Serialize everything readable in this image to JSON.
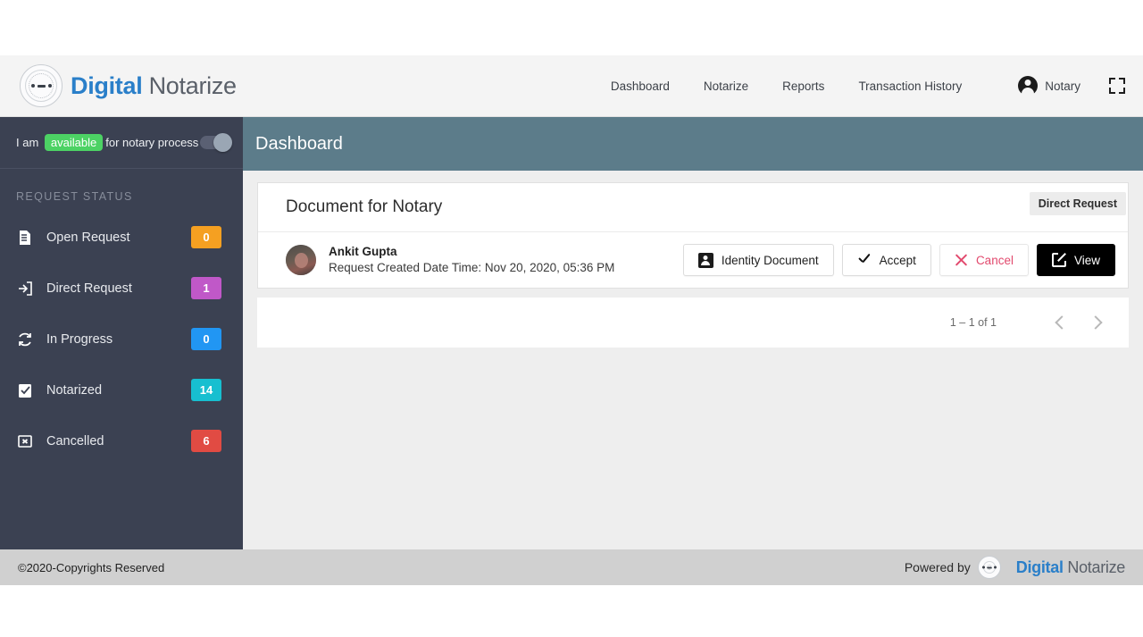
{
  "brand": {
    "part1": "Digital",
    "part2": " Notarize"
  },
  "topnav": {
    "links": [
      {
        "label": "Dashboard"
      },
      {
        "label": "Notarize"
      },
      {
        "label": "Reports"
      },
      {
        "label": "Transaction History"
      }
    ],
    "user_label": "Notary",
    "user_icon": "account-circle-icon",
    "fullscreen_icon": "fullscreen-icon"
  },
  "sidebar": {
    "availability": {
      "prefix": "I am",
      "status": "available",
      "suffix": "for notary process",
      "toggle_on": false
    },
    "section_label": "REQUEST STATUS",
    "items": [
      {
        "label": "Open Request",
        "count": "0",
        "color": "#f5a021",
        "icon": "document-icon"
      },
      {
        "label": "Direct Request",
        "count": "1",
        "color": "#c058c8",
        "icon": "arrow-into-box-icon"
      },
      {
        "label": "In Progress",
        "count": "0",
        "color": "#2196f3",
        "icon": "sync-icon"
      },
      {
        "label": "Notarized",
        "count": "14",
        "color": "#17bfd0",
        "icon": "clipboard-check-icon"
      },
      {
        "label": "Cancelled",
        "count": "6",
        "color": "#e14b43",
        "icon": "box-x-icon"
      }
    ]
  },
  "page": {
    "title": "Dashboard",
    "card": {
      "title": "Document for Notary",
      "tag": "Direct Request",
      "row": {
        "name": "Ankit Gupta",
        "meta": "Request Created Date Time: Nov 20, 2020, 05:36 PM",
        "avatar_icon": "user-avatar"
      },
      "buttons": [
        {
          "label": "Identity Document",
          "icon": "id-card-icon",
          "style": "default"
        },
        {
          "label": "Accept",
          "icon": "check-icon",
          "style": "default"
        },
        {
          "label": "Cancel",
          "icon": "close-x-icon",
          "style": "cancel"
        },
        {
          "label": "View",
          "icon": "open-external-icon",
          "style": "view"
        }
      ]
    },
    "pagination": {
      "range": "1 – 1 of 1",
      "prev_icon": "chevron-left-icon",
      "next_icon": "chevron-right-icon"
    }
  },
  "footer": {
    "copyright": "©2020-Copyrights Reserved",
    "powered_by": "Powered by"
  },
  "colors": {
    "sidebar_bg": "#3b4152",
    "page_header_bg": "#5c7c8a",
    "brand_blue": "#2a7fc9",
    "available_green": "#4cd264",
    "cancel_red": "#e24a6e"
  }
}
